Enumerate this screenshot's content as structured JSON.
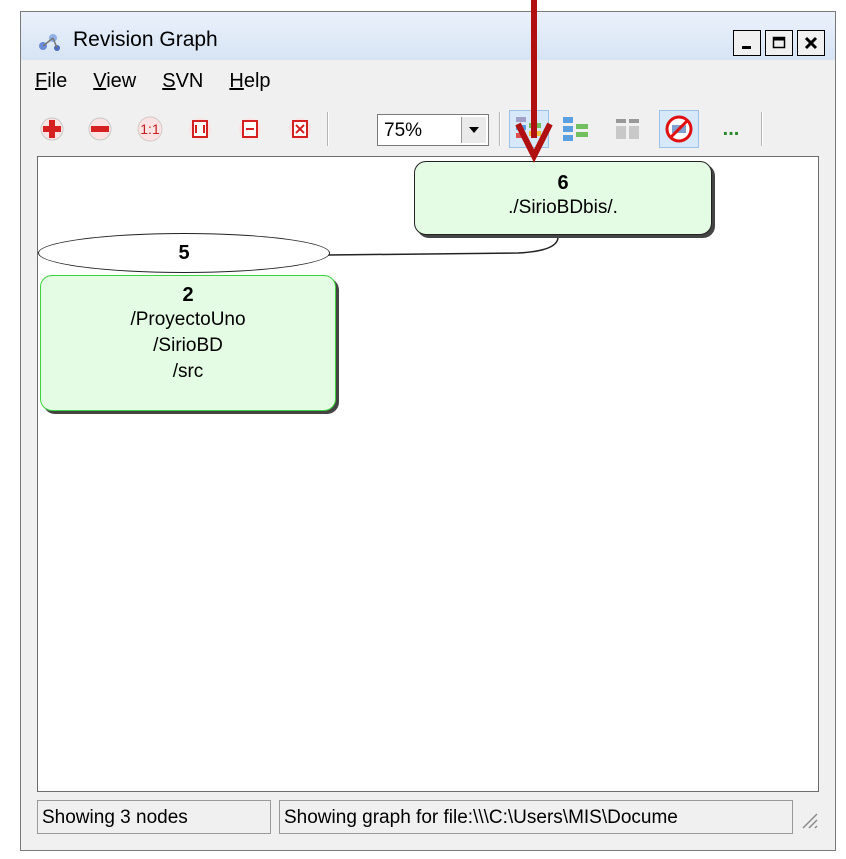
{
  "window": {
    "title": "Revision Graph"
  },
  "menu": [
    {
      "label": "File",
      "mnemonic": "F",
      "rest": "ile"
    },
    {
      "label": "View",
      "mnemonic": "V",
      "rest": "iew"
    },
    {
      "label": "SVN",
      "mnemonic": "S",
      "rest": "VN"
    },
    {
      "label": "Help",
      "mnemonic": "H",
      "rest": "elp"
    }
  ],
  "toolbar": {
    "zoom_value": "75%",
    "zoom_in_icon": "plus-icon",
    "zoom_out_icon": "minus-icon",
    "actual_size_label": "1:1",
    "more_label": "..."
  },
  "graph": {
    "nodes": [
      {
        "revision": "6",
        "paths": [
          "./SirioBDbis/."
        ]
      },
      {
        "revision": "2",
        "paths": [
          "/ProyectoUno",
          "/SirioBD",
          "/src"
        ]
      }
    ],
    "tag_ellipse": {
      "revision": "5"
    }
  },
  "status": {
    "nodes": "Showing 3 nodes",
    "file": "Showing graph for file:\\\\\\C:\\Users\\MIS\\Docume"
  },
  "colors": {
    "node_fill": "#e4fbe4",
    "node_selected_border": "#3cd23c",
    "annotation_arrow": "#b01010"
  }
}
